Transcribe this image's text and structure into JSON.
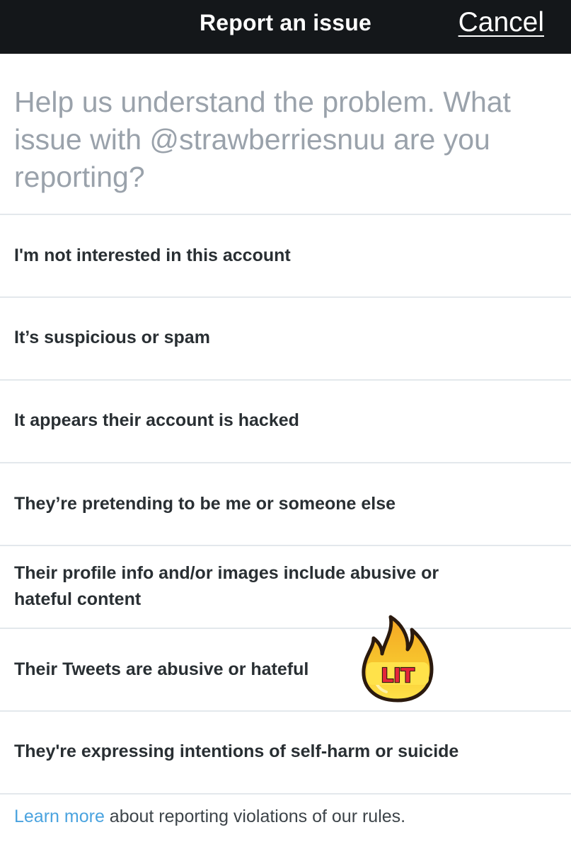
{
  "header": {
    "title": "Report an issue",
    "cancel_label": "Cancel"
  },
  "prompt": "Help us understand the problem. What issue with @strawberriesnuu are you reporting?",
  "options": [
    {
      "label": "I'm not interested in this account"
    },
    {
      "label": "It’s suspicious or spam"
    },
    {
      "label": "It appears their account is hacked"
    },
    {
      "label": "They’re pretending to be me or someone else"
    },
    {
      "label": "Their profile info and/or images include abusive or hateful content"
    },
    {
      "label": "Their Tweets are abusive or hateful"
    },
    {
      "label": "They're expressing intentions of self-harm or suicide"
    }
  ],
  "footer": {
    "link_text": "Learn more",
    "text": " about reporting violations of our rules."
  },
  "sticker": {
    "text": "LIT",
    "icon": "fire-icon"
  },
  "colors": {
    "header_bg": "#14171a",
    "link": "#4aa3df",
    "prompt_text": "#9aa2ab"
  }
}
